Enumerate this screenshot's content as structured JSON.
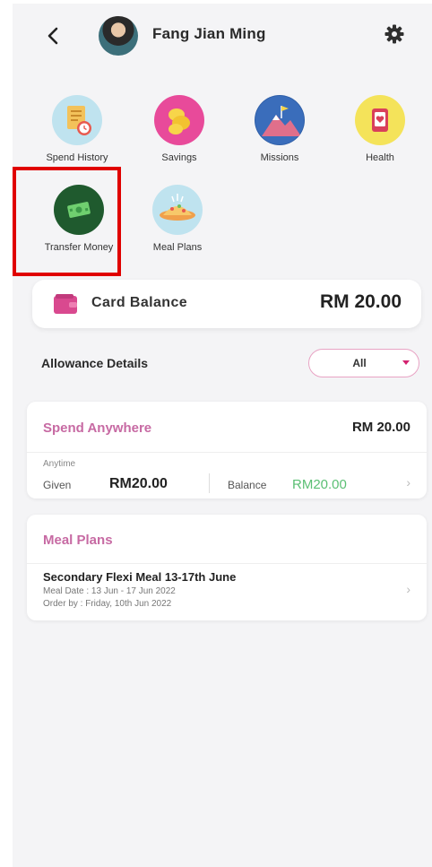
{
  "header": {
    "user_name": "Fang Jian Ming"
  },
  "shortcuts": [
    {
      "label": "Spend History",
      "icon": "spend-history-icon"
    },
    {
      "label": "Savings",
      "icon": "savings-icon"
    },
    {
      "label": "Missions",
      "icon": "missions-icon"
    },
    {
      "label": "Health",
      "icon": "health-icon"
    },
    {
      "label": "Transfer Money",
      "icon": "transfer-money-icon"
    },
    {
      "label": "Meal Plans",
      "icon": "meal-plans-icon"
    }
  ],
  "card_balance": {
    "label": "Card Balance",
    "amount": "RM 20.00",
    "icon": "wallet-icon"
  },
  "allowance": {
    "title": "Allowance Details",
    "filter_value": "All"
  },
  "spend_anywhere": {
    "title": "Spend Anywhere",
    "total": "RM 20.00",
    "period": "Anytime",
    "given_label": "Given",
    "given_value": "RM20.00",
    "balance_label": "Balance",
    "balance_value": "RM20.00"
  },
  "meal_plans": {
    "title": "Meal Plans",
    "item_name": "Secondary Flexi Meal 13-17th June",
    "meal_date": "Meal Date : 13 Jun - 17 Jun 2022",
    "order_by": "Order by : Friday, 10th Jun 2022"
  },
  "colors": {
    "accent_pink": "#c76aa3",
    "balance_green": "#5bbf74",
    "highlight_red": "#e00000"
  }
}
